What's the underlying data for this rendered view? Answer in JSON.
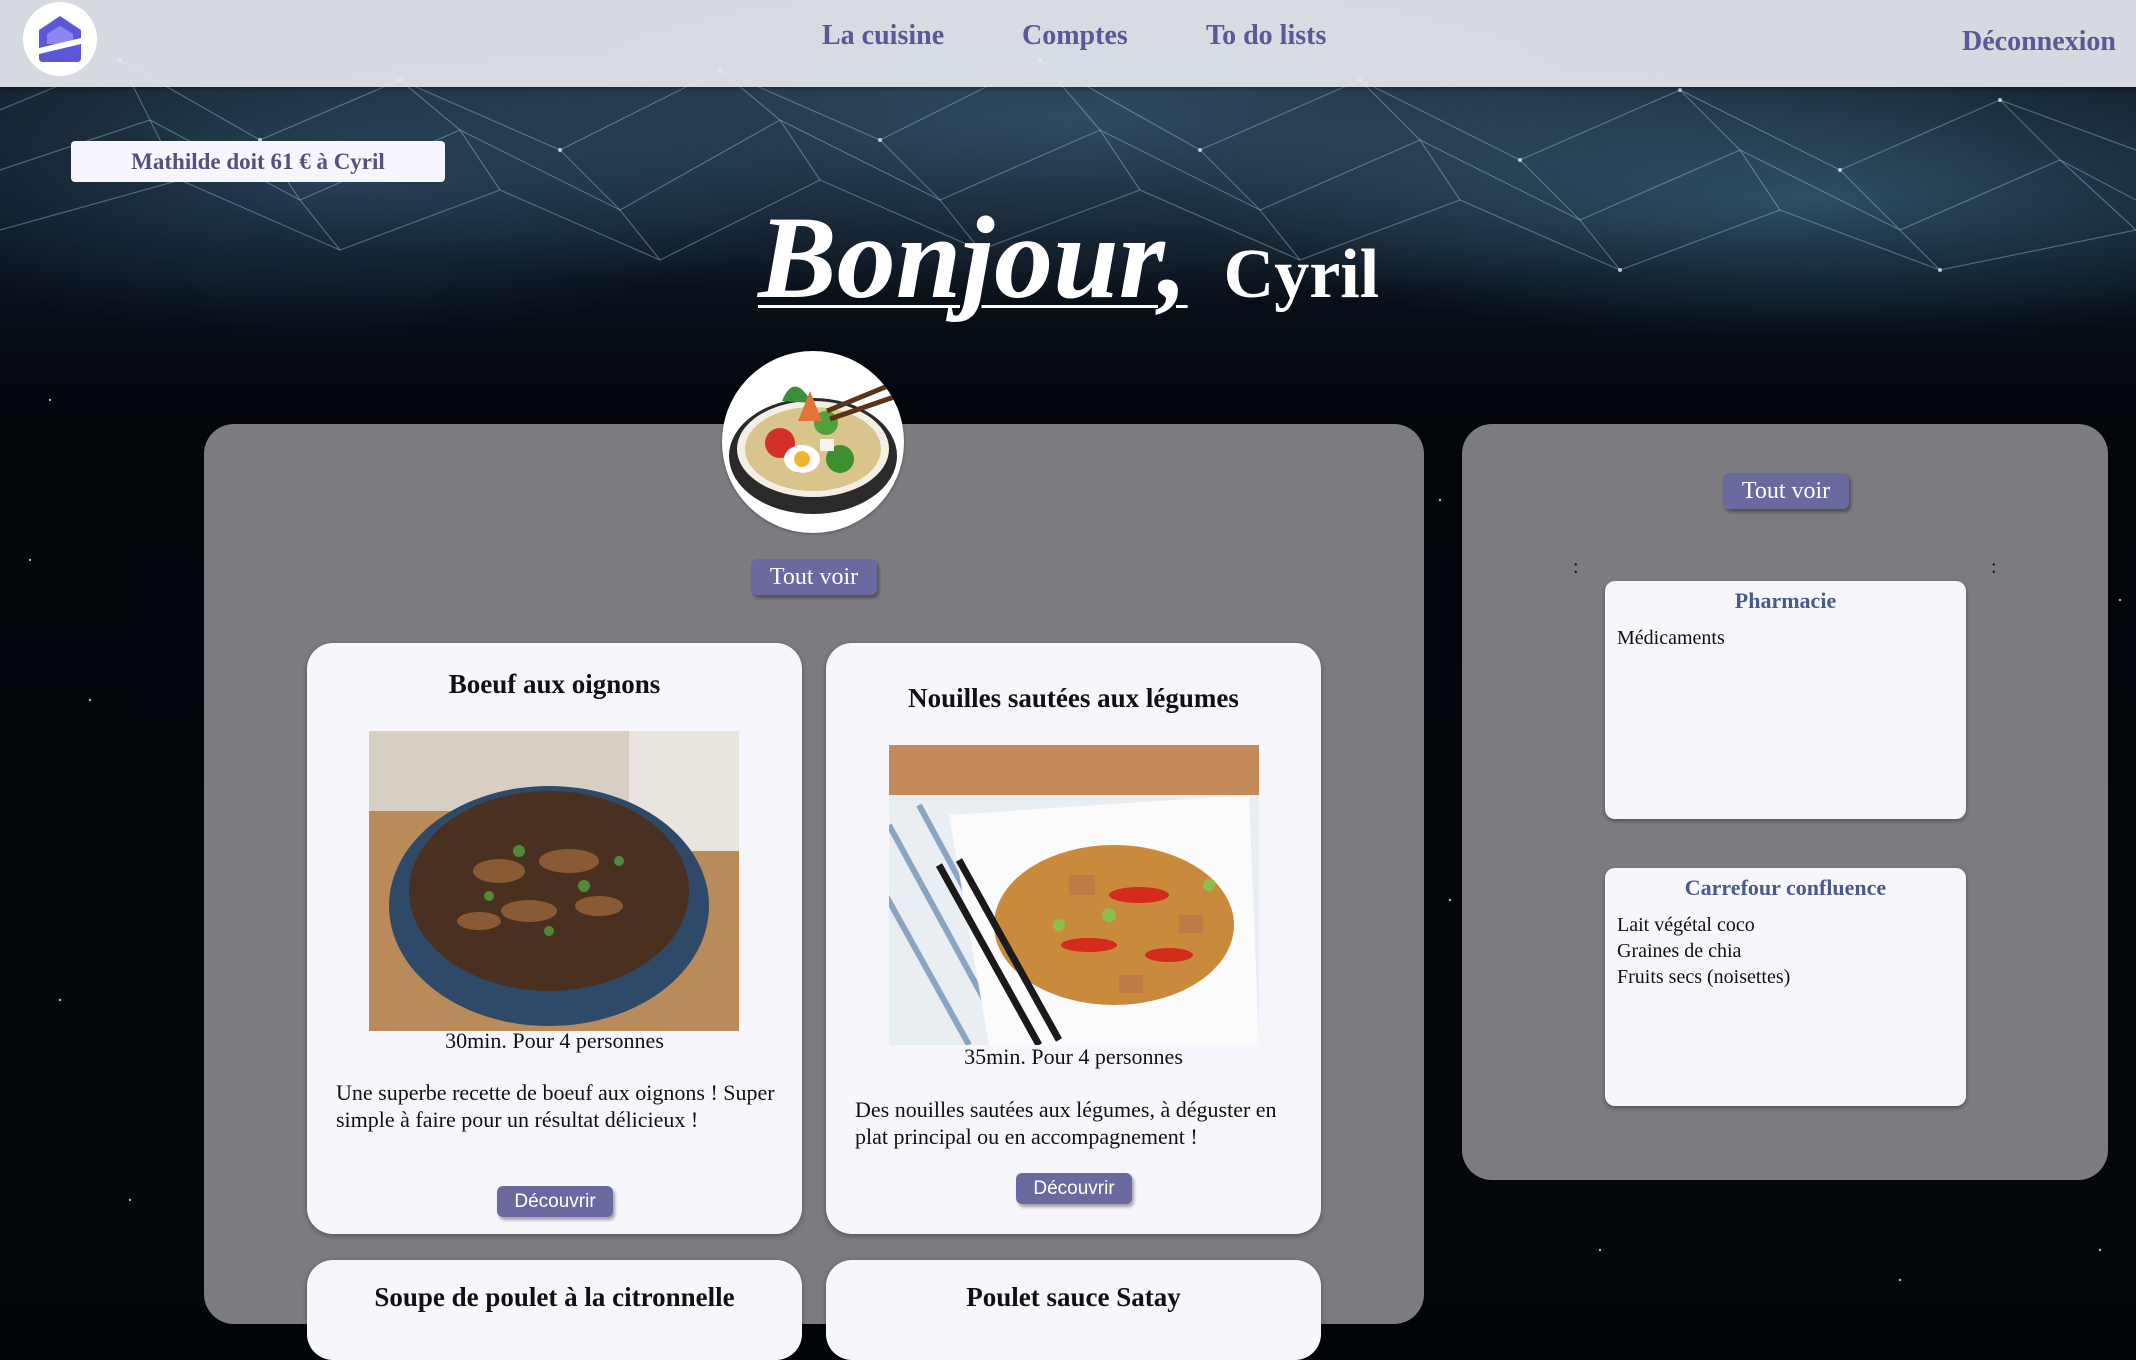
{
  "nav": {
    "home_icon": "house-icon",
    "links": [
      "La cuisine",
      "Comptes",
      "To do lists"
    ],
    "logout": "Déconnexion"
  },
  "debt_banner": "Mathilde doit 61 € à Cyril",
  "greeting": {
    "hello": "Bonjour,",
    "name": "Cyril"
  },
  "kitchen": {
    "see_all": "Tout voir",
    "recipes": [
      {
        "title": "Boeuf aux oignons",
        "meta": "30min.  Pour 4 personnes",
        "description": "Une superbe recette de boeuf aux oignons ! Super simple à faire pour un résultat délicieux !",
        "button": "Découvrir"
      },
      {
        "title": "Nouilles sautées aux légumes",
        "meta": "35min.  Pour 4 personnes",
        "description": "Des nouilles sautées aux légumes, à déguster en plat principal ou en accompagnement !",
        "button": "Découvrir"
      },
      {
        "title": "Soupe de poulet à la citronnelle"
      },
      {
        "title": "Poulet sauce Satay"
      }
    ]
  },
  "todo": {
    "see_all": "Tout voir",
    "colon_left": ":",
    "colon_right": ":",
    "lists": [
      {
        "title": "Pharmacie",
        "items": [
          "Médicaments"
        ]
      },
      {
        "title": "Carrefour confluence",
        "items": [
          "Lait végétal coco",
          "Graines de chia",
          "Fruits secs (noisettes)"
        ]
      }
    ]
  },
  "colors": {
    "accent": "#6a6aa0",
    "nav_text": "#5a5896",
    "panel": "#808084",
    "card": "#f6f6fc"
  }
}
